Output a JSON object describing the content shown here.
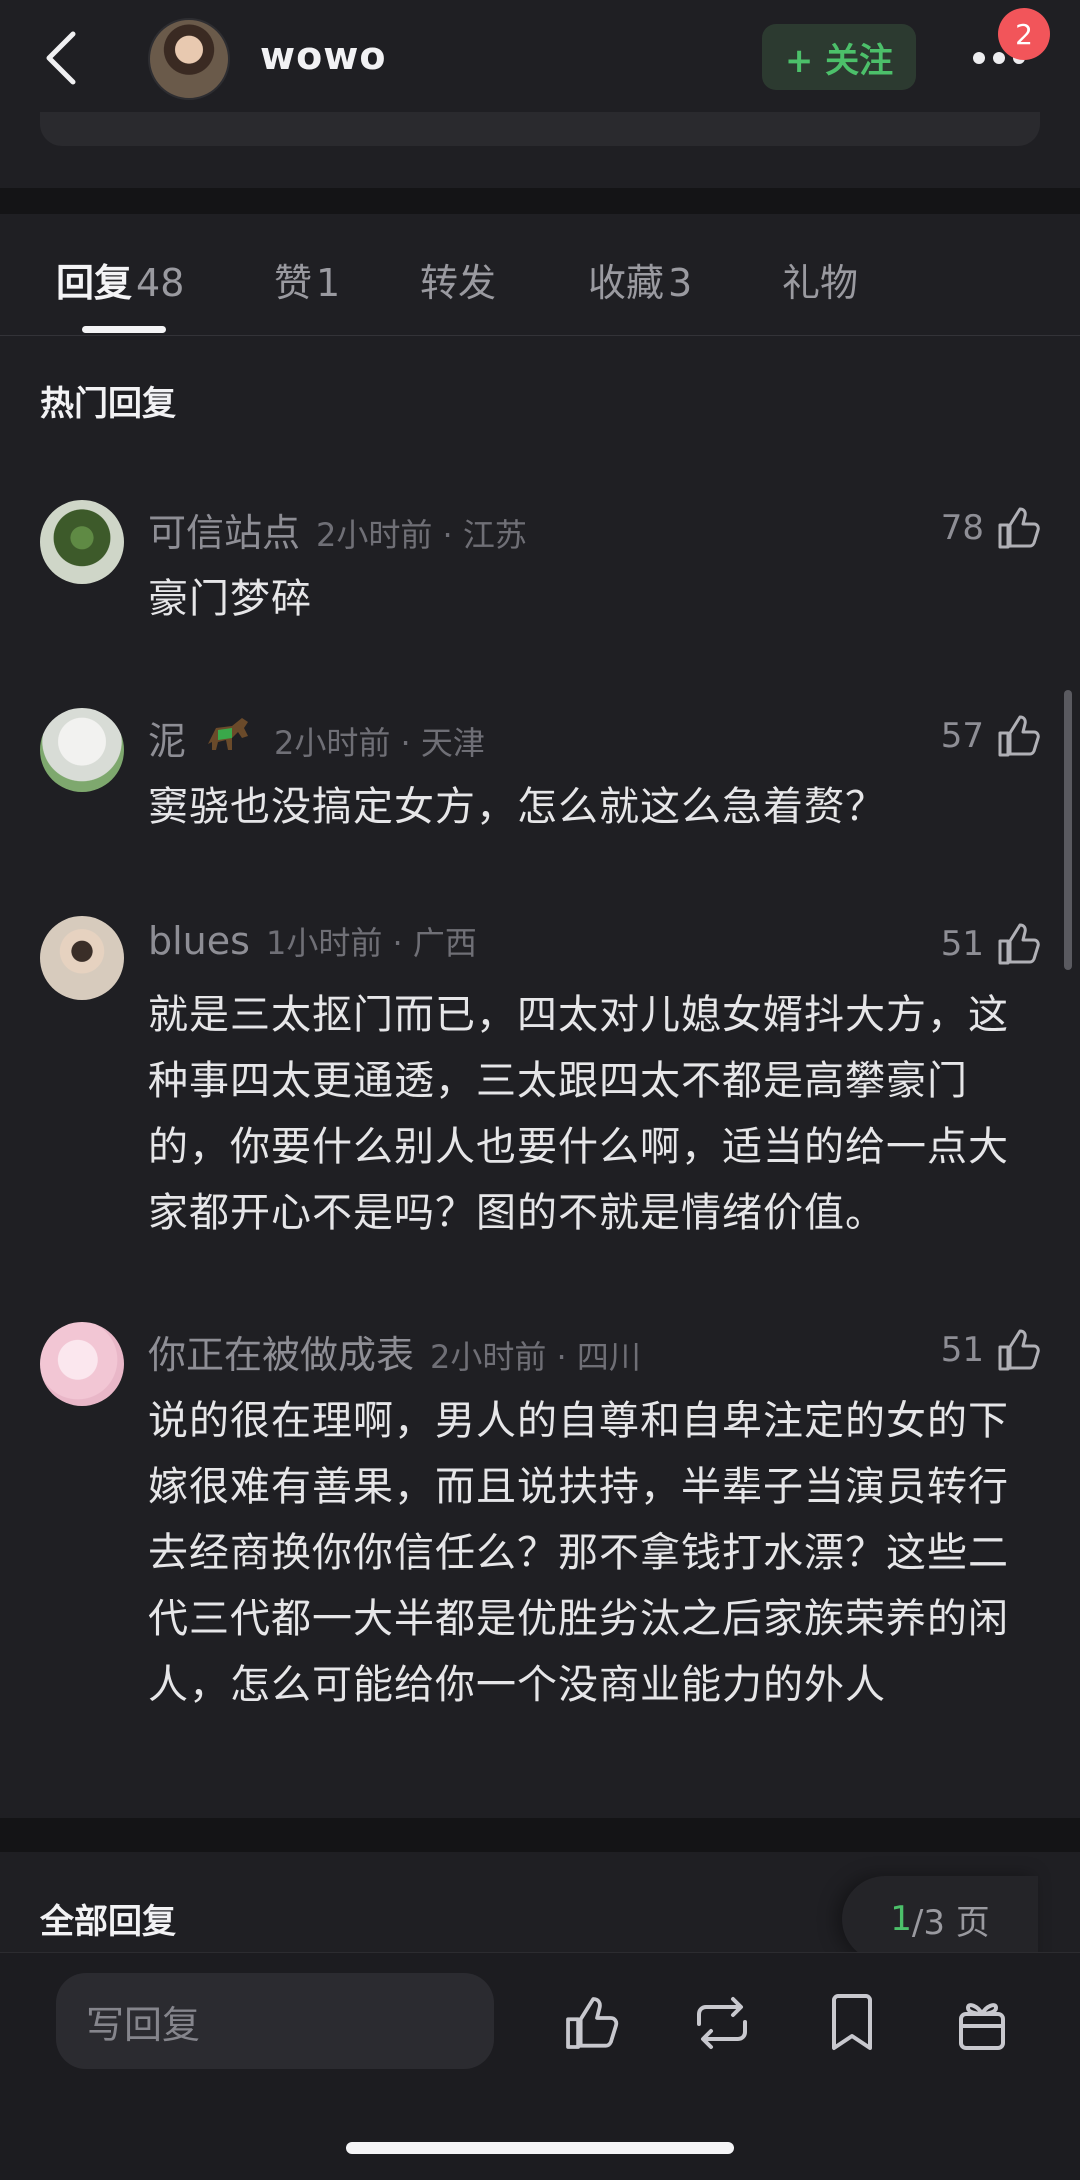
{
  "header": {
    "user_name": "wowo",
    "follow_label": "+ 关注",
    "notification_count": "2"
  },
  "tabs": [
    {
      "label": "回复",
      "count": "48"
    },
    {
      "label": "赞",
      "count": "1"
    },
    {
      "label": "转发",
      "count": ""
    },
    {
      "label": "收藏",
      "count": "3"
    },
    {
      "label": "礼物",
      "count": ""
    }
  ],
  "hot_title": "热门回复",
  "comments": [
    {
      "name": "可信站点",
      "meta": "2小时前 · 江苏",
      "likes": "78",
      "text": "豪门梦碎"
    },
    {
      "name": "泥",
      "meta": "2小时前 · 天津",
      "likes": "57",
      "text": "窦骁也没搞定女方，怎么就这么急着赘？"
    },
    {
      "name": "blues",
      "meta": "1小时前 · 广西",
      "likes": "51",
      "text": "就是三太抠门而已，四太对儿媳女婿抖大方，这种事四太更通透，三太跟四太不都是高攀豪门的，你要什么别人也要什么啊，适当的给一点大家都开心不是吗？图的不就是情绪价值。"
    },
    {
      "name": "你正在被做成表",
      "meta": "2小时前 · 四川",
      "likes": "51",
      "text": "说的很在理啊，男人的自尊和自卑注定的女的下嫁很难有善果，而且说扶持，半辈子当演员转行去经商换你你信任么？那不拿钱打水漂？这些二代三代都一大半都是优胜劣汰之后家族荣养的闲人，怎么可能给你一个没商业能力的外人"
    }
  ],
  "all_title": "全部回复",
  "pagination": {
    "current": "1",
    "total": "/3 页"
  },
  "bottom": {
    "reply_placeholder": "写回复"
  },
  "colors": {
    "accent_green": "#4cc06a",
    "badge_red": "#f2555a",
    "background": "#1f1f23"
  }
}
